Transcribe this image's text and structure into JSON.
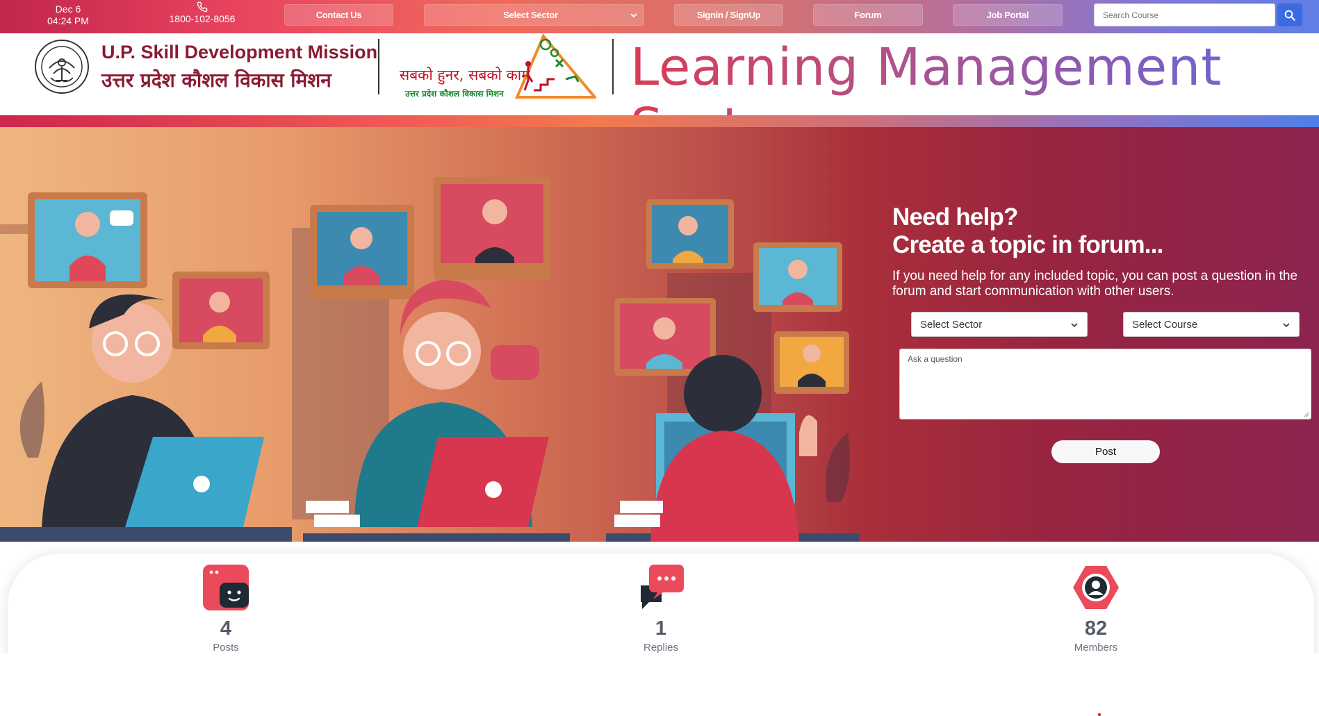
{
  "topbar": {
    "date": "Dec 6",
    "time": "04:24 PM",
    "phone": "1800-102-8056",
    "nav": {
      "contact": "Contact Us",
      "sector": "Select Sector",
      "signin": "Signin / SignUp",
      "forum": "Forum",
      "jobs": "Job Portal"
    },
    "search_placeholder": "Search Course"
  },
  "header": {
    "org_en": "U.P. Skill Development Mission",
    "org_hi": "उत्तर प्रदेश कौशल विकास मिशन",
    "tagline_hi": "सबको हुनर, सबको काम",
    "tagline_sub": "उत्तर प्रदेश कौशल विकास मिशन",
    "title": "Learning Management System"
  },
  "hero": {
    "heading_line1": "Need help?",
    "heading_line2": "Create a topic in forum...",
    "description": "If you need help for any included topic, you can post a question in the forum and start communication with other users.",
    "sector_select": "Select Sector",
    "course_select": "Select Course",
    "question_placeholder": "Ask a question",
    "post_label": "Post"
  },
  "stats": [
    {
      "value": "4",
      "label": "Posts",
      "icon": "chat-face-icon"
    },
    {
      "value": "1",
      "label": "Replies",
      "icon": "replies-bubble-icon"
    },
    {
      "value": "82",
      "label": "Members",
      "icon": "member-hexagon-icon"
    }
  ],
  "colors": {
    "primary_red": "#d83d55",
    "brand_maroon": "#8a1a33",
    "accent_blue": "#3b6be0",
    "hero_dark": "#982440"
  }
}
